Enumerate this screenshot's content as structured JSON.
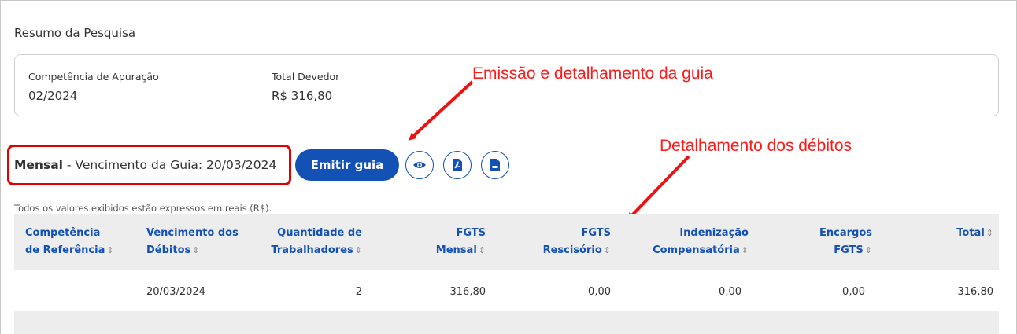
{
  "summary": {
    "title": "Resumo da Pesquisa",
    "competencia_label": "Competência de Apuração",
    "competencia_value": "02/2024",
    "total_label": "Total Devedor",
    "total_value": "R$ 316,80"
  },
  "annotations": {
    "emissao": "Emissão e detalhamento da guia",
    "debitos": "Detalhamento dos débitos",
    "color": "#ff1a1a"
  },
  "guia": {
    "periodicidade": "Mensal",
    "vencimento_text": " - Vencimento da Guia: 20/03/2024",
    "emitir_label": "Emitir guia",
    "icons": [
      "eye-icon",
      "pdf-icon",
      "document-icon"
    ]
  },
  "table": {
    "note": "Todos os valores exibidos estão expressos em reais (R$).",
    "sort_glyph": "⇕",
    "headers": [
      {
        "line1": "Competência",
        "line2": "de Referência"
      },
      {
        "line1": "Vencimento dos",
        "line2": "Débitos"
      },
      {
        "line1": "Quantidade de",
        "line2": "Trabalhadores"
      },
      {
        "line1": "FGTS",
        "line2": "Mensal"
      },
      {
        "line1": "FGTS",
        "line2": "Rescisório"
      },
      {
        "line1": "Indenização",
        "line2": "Compensatória"
      },
      {
        "line1": "Encargos",
        "line2": "FGTS"
      },
      {
        "line1": "",
        "line2": "Total"
      }
    ],
    "rows": [
      [
        "",
        "20/03/2024",
        "2",
        "316,80",
        "0,00",
        "0,00",
        "0,00",
        "316,80"
      ]
    ]
  },
  "colors": {
    "accent": "#1351b4",
    "highlight_border": "#e00000",
    "header_bg": "#ededed"
  }
}
